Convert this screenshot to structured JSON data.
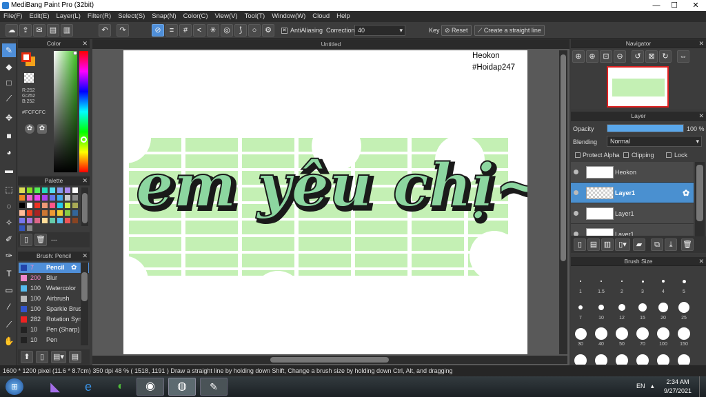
{
  "window": {
    "title": "MediBang Paint Pro (32bit)",
    "minimize": "—",
    "maximize": "☐",
    "close": "✕"
  },
  "menu": [
    "File(F)",
    "Edit(E)",
    "Layer(L)",
    "Filter(R)",
    "Select(S)",
    "Snap(N)",
    "Color(C)",
    "View(V)",
    "Tool(T)",
    "Window(W)",
    "Cloud",
    "Help"
  ],
  "toolbar": {
    "antialiasing_label": "AntiAliasing",
    "correction_label": "Correction",
    "correction_value": "40",
    "key_label": "Key",
    "reset_label": "Reset",
    "straight_line_label": "Create a straight line"
  },
  "color_panel": {
    "title": "Color",
    "r": "R:252",
    "g": "G:252",
    "b": "B:252",
    "hex": "#FCFCFC",
    "primary": "#e82d10",
    "secondary": "#f4a21b"
  },
  "palette_panel": {
    "title": "Palette",
    "footer": "---",
    "colors": [
      "#dddd55",
      "#88dd22",
      "#55ee55",
      "#22ddbb",
      "#55ddee",
      "#8899ee",
      "#aa88ee",
      "#ffffff",
      "#ee8822",
      "#ee66cc",
      "#ee44ee",
      "#aa44ee",
      "#6677ee",
      "#44aaee",
      "#cccccc",
      "#888888",
      "#000000",
      "#ffffff",
      "#ee3322",
      "#ee9977",
      "#ff5588",
      "#22ccee",
      "#ccee44",
      "#aaaa55",
      "#ffbb99",
      "#ee4422",
      "#aa2222",
      "#cc7733",
      "#ee9933",
      "#eecc33",
      "#88cc44",
      "#336699",
      "#7777ee",
      "#aa77dd",
      "#dd6688",
      "#ffdd99",
      "#66ccaa",
      "#55bbee",
      "#ee5555",
      "#884422",
      "#3355bb",
      "#888888"
    ]
  },
  "brush_panel": {
    "title": "Brush: Pencil",
    "brushes": [
      {
        "size": "7",
        "name": "Pencil",
        "color": "#2244aa"
      },
      {
        "size": "200",
        "name": "Blur",
        "color": "#ee88cc"
      },
      {
        "size": "100",
        "name": "Watercolor",
        "color": "#55bbee"
      },
      {
        "size": "100",
        "name": "Airbrush",
        "color": "#bbbbbb"
      },
      {
        "size": "100",
        "name": "Sparkle Brush",
        "color": "#3355cc"
      },
      {
        "size": "282",
        "name": "Rotation Sym",
        "color": "#ee2222"
      },
      {
        "size": "10",
        "name": "Pen (Sharp)",
        "color": "#222222"
      },
      {
        "size": "10",
        "name": "Pen",
        "color": "#222222"
      }
    ]
  },
  "document": {
    "tab": "Untitled",
    "watermark_line1": "Heokon",
    "watermark_line2": "#Hoidap247",
    "lettering": "em yêu chị~"
  },
  "navigator": {
    "title": "Navigator"
  },
  "layer_panel": {
    "title": "Layer",
    "opacity_label": "Opacity",
    "opacity_value": "100 %",
    "opacity": 1.0,
    "blending_label": "Blending",
    "blending_value": "Normal",
    "protect_alpha": "Protect Alpha",
    "clipping": "Clipping",
    "lock": "Lock",
    "layers": [
      "Heokon",
      "Layer1",
      "Layer1",
      "Layer1"
    ]
  },
  "brush_size": {
    "title": "Brush Size",
    "sizes": [
      "1",
      "1.5",
      "2",
      "3",
      "4",
      "5",
      "7",
      "10",
      "12",
      "15",
      "20",
      "25",
      "30",
      "40",
      "50",
      "70",
      "100",
      "150"
    ]
  },
  "status": "1600 * 1200 pixel   (11.6 * 8.7cm)   350 dpi   48 %   ( 1518, 1191 )   Draw a straight line by holding down Shift, Change a brush size by holding down Ctrl, Alt, and dragging",
  "taskbar": {
    "language": "EN",
    "time": "2:34 AM",
    "date": "9/27/2021"
  }
}
